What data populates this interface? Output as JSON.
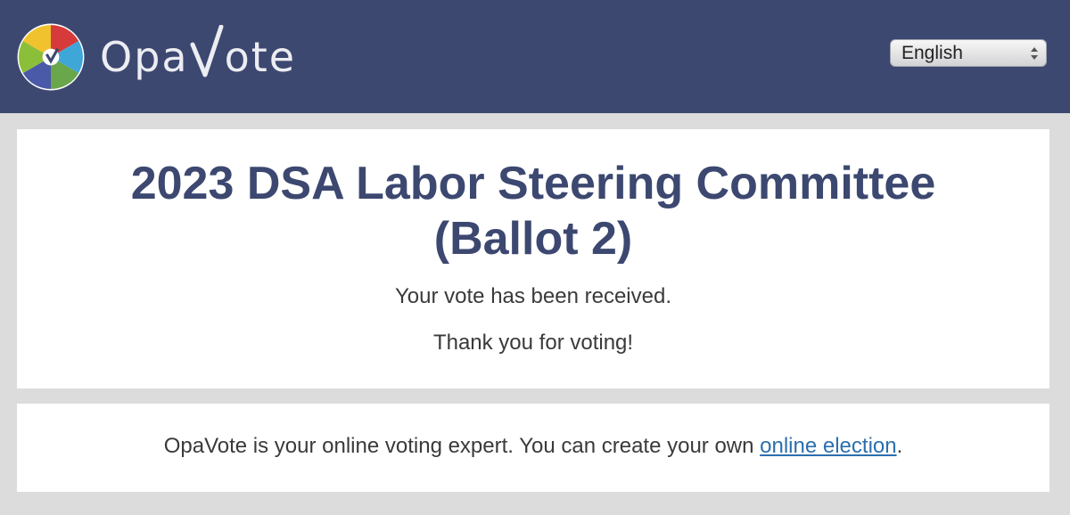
{
  "header": {
    "logo_text_before": "Opa",
    "logo_text_after": "ote",
    "language": "English",
    "colors": {
      "background": "#3c4870"
    }
  },
  "main": {
    "title_line1": "2023 DSA Labor Steering Committee",
    "title_line2": "(Ballot 2)",
    "message1": "Your vote has been received.",
    "message2": "Thank you for voting!"
  },
  "footer": {
    "text": "OpaVote is your online voting expert. You can create your own ",
    "link_text": "online election",
    "text_after": "."
  }
}
